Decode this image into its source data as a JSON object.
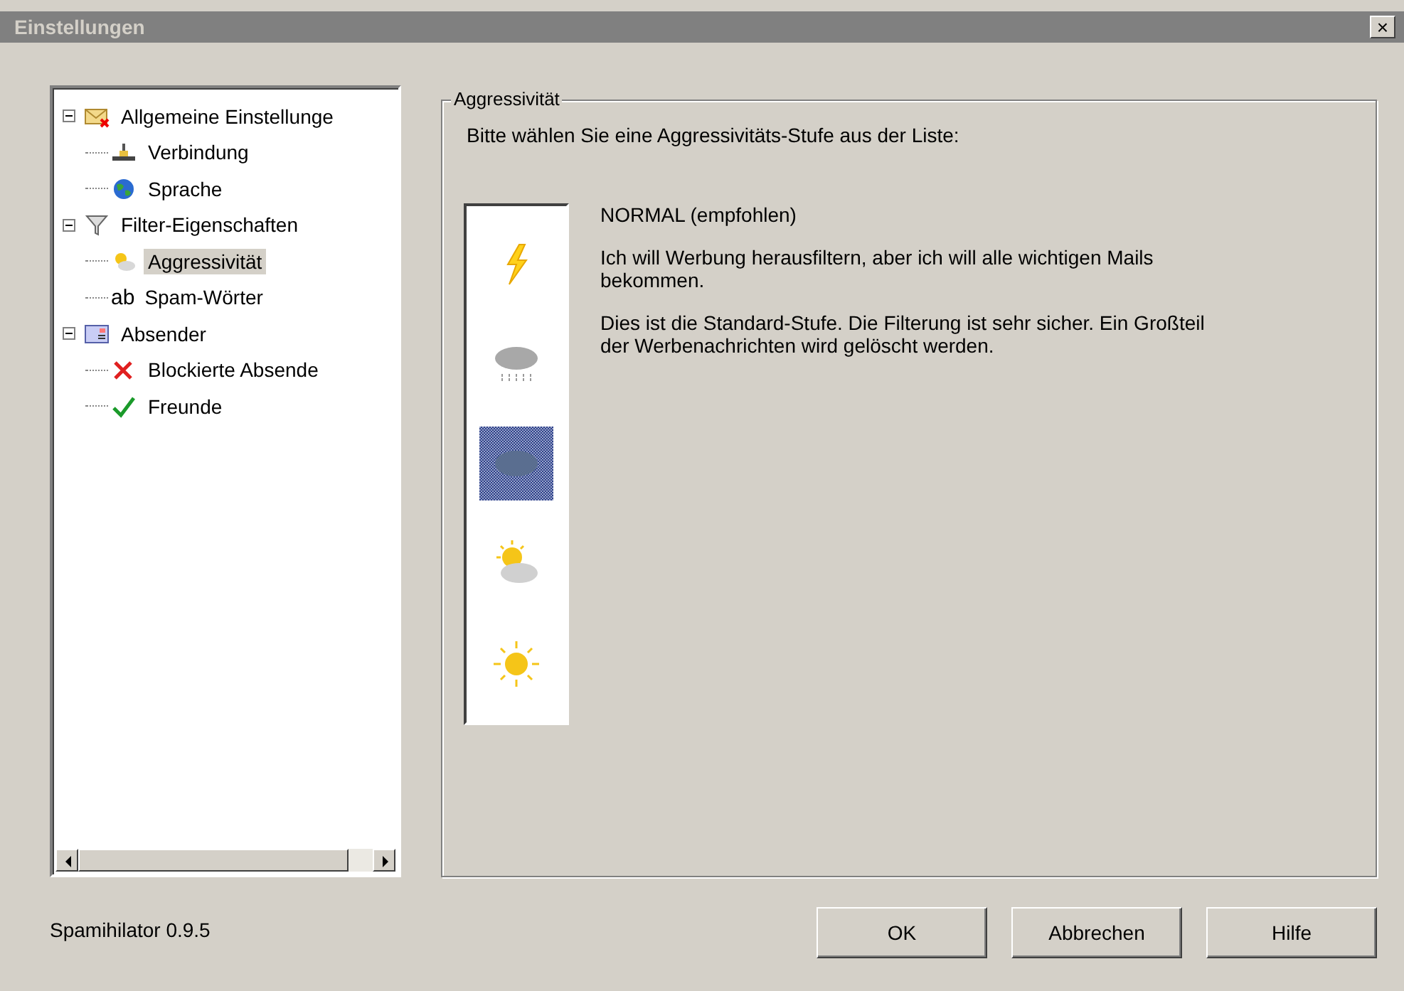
{
  "window": {
    "title": "Einstellungen",
    "close": "×"
  },
  "tree": [
    {
      "label": "Allgemeine Einstellunge",
      "kind": "mail",
      "selected": false,
      "expanded": true,
      "children": [
        {
          "label": "Verbindung",
          "kind": "network",
          "selected": false
        },
        {
          "label": "Sprache",
          "kind": "globe",
          "selected": false
        }
      ]
    },
    {
      "label": "Filter-Eigenschaften",
      "kind": "filter",
      "selected": false,
      "expanded": true,
      "children": [
        {
          "label": "Aggressivität",
          "kind": "suncloud",
          "selected": true
        },
        {
          "label": "Spam-Wörter",
          "kind": "ab",
          "selected": false
        }
      ]
    },
    {
      "label": "Absender",
      "kind": "card",
      "selected": false,
      "expanded": true,
      "children": [
        {
          "label": "Blockierte Absende",
          "kind": "cross",
          "selected": false
        },
        {
          "label": "Freunde",
          "kind": "check",
          "selected": false
        }
      ]
    }
  ],
  "group": {
    "title": "Aggressivität",
    "prompt": "Bitte wählen Sie eine Aggressivitäts-Stufe aus der Liste:",
    "levels": [
      {
        "kind": "lightning",
        "selected": false
      },
      {
        "kind": "rain",
        "selected": false
      },
      {
        "kind": "cloud",
        "selected": true
      },
      {
        "kind": "suncloud",
        "selected": false
      },
      {
        "kind": "sun",
        "selected": false
      }
    ],
    "heading": "NORMAL (empfohlen)",
    "paragraphs": [
      "Ich will Werbung herausfiltern, aber ich will alle wichtigen Mails bekommen.",
      "Dies ist die Standard-Stufe. Die Filterung ist sehr sicher. Ein Großteil der Werbenachrichten wird gelöscht werden."
    ]
  },
  "version": "Spamihilator 0.9.5",
  "buttons": [
    "OK",
    "Abbrechen",
    "Hilfe"
  ]
}
